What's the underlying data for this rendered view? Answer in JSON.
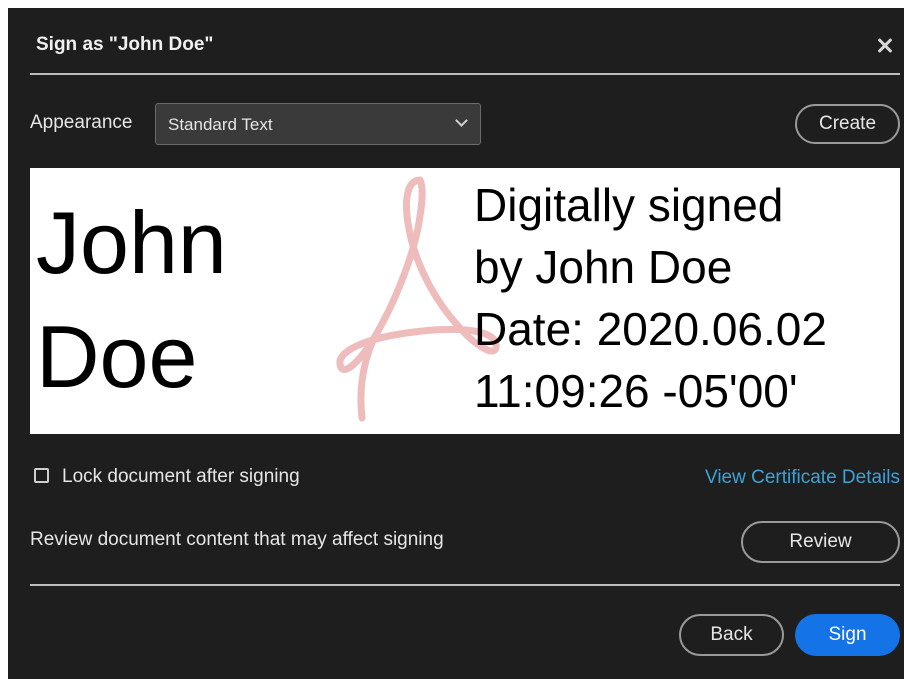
{
  "dialog": {
    "title": "Sign as \"John Doe\"",
    "close_icon": "close-icon"
  },
  "appearance": {
    "label": "Appearance",
    "selected": "Standard Text",
    "dropdown_icon": "chevron-down-icon",
    "create_label": "Create"
  },
  "preview": {
    "name_lines": [
      "John",
      "Doe"
    ],
    "detail_lines": [
      "Digitally signed",
      "by John Doe",
      "Date: 2020.06.02",
      "11:09:26 -05'00'"
    ],
    "watermark_icon": "acrobat-logo-icon",
    "watermark_color": "#e8a0a0"
  },
  "options": {
    "lock_label": "Lock document after signing",
    "lock_checked": false,
    "certificate_link": "View Certificate Details",
    "review_text": "Review document content that may affect signing",
    "review_label": "Review"
  },
  "footer": {
    "back_label": "Back",
    "sign_label": "Sign"
  },
  "colors": {
    "dialog_background": "#1e1e1e",
    "accent": "#1473e6",
    "link": "#3ea2d8"
  }
}
